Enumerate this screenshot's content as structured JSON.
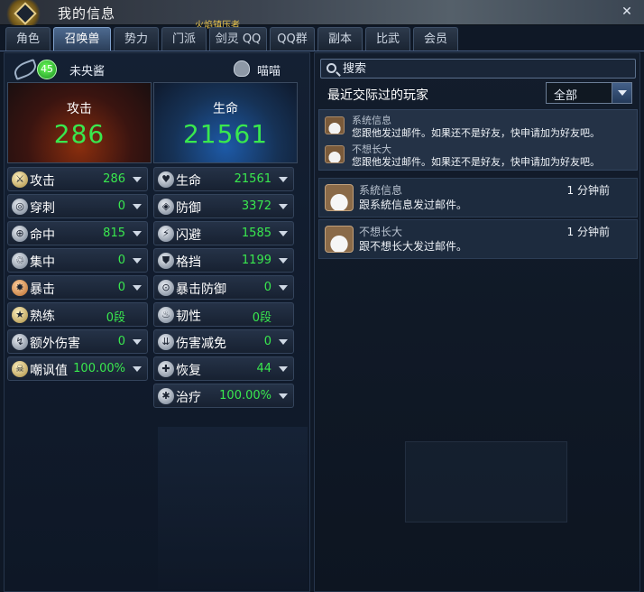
{
  "window": {
    "title": "我的信息",
    "close": "✕",
    "decoration": "火焰镇压者"
  },
  "tabs": [
    "角色",
    "召唤兽",
    "势力",
    "门派",
    "剑灵 QQ",
    "QQ群",
    "副本",
    "比武",
    "会员"
  ],
  "active_tab": "召唤兽",
  "pet": {
    "level": "45",
    "name": "未央酱",
    "owner": "喵喵"
  },
  "cards": {
    "attack": {
      "label": "攻击",
      "value": "286"
    },
    "life": {
      "label": "生命",
      "value": "21561"
    }
  },
  "left_stats": [
    {
      "icon": "swords-icon",
      "label": "攻击",
      "value": "286"
    },
    {
      "icon": "pierce-icon",
      "label": "穿刺",
      "value": "0"
    },
    {
      "icon": "target-icon",
      "label": "命中",
      "value": "815"
    },
    {
      "icon": "focus-icon",
      "label": "集中",
      "value": "0"
    },
    {
      "icon": "burst-icon",
      "label": "暴击",
      "value": "0"
    },
    {
      "icon": "mastery-icon",
      "label": "熟练",
      "value": "0段"
    },
    {
      "icon": "bonus-damage-icon",
      "label": "额外伤害",
      "value": "0"
    },
    {
      "icon": "skull-icon",
      "label": "嘲讽值",
      "value": "100.00%"
    }
  ],
  "right_stats": [
    {
      "icon": "heart-icon",
      "label": "生命",
      "value": "21561"
    },
    {
      "icon": "shield-icon",
      "label": "防御",
      "value": "3372"
    },
    {
      "icon": "dodge-icon",
      "label": "闪避",
      "value": "1585"
    },
    {
      "icon": "block-icon",
      "label": "格挡",
      "value": "1199"
    },
    {
      "icon": "crit-defense-icon",
      "label": "暴击防御",
      "value": "0"
    },
    {
      "icon": "toughness-icon",
      "label": "韧性",
      "value": "0段"
    },
    {
      "icon": "damage-reduction-icon",
      "label": "伤害减免",
      "value": "0"
    },
    {
      "icon": "recovery-icon",
      "label": "恢复",
      "value": "44"
    },
    {
      "icon": "heal-icon",
      "label": "治疗",
      "value": "100.00%"
    }
  ],
  "search": {
    "placeholder": "搜索"
  },
  "recent": {
    "title": "最近交际过的玩家",
    "filter": "全部"
  },
  "notices": [
    {
      "name": "系统信息",
      "text": "您跟他发过邮件。如果还不是好友，快申请加为好友吧。"
    },
    {
      "name": "不想长大",
      "text": "您跟他发过邮件。如果还不是好友，快申请加为好友吧。"
    }
  ],
  "messages": [
    {
      "name": "系統信息",
      "time": "1 分钟前",
      "text": "跟系統信息发过邮件。"
    },
    {
      "name": "不想长大",
      "time": "1 分钟前",
      "text": "跟不想长大发过邮件。"
    }
  ],
  "colors": {
    "value_green": "#39e84e",
    "accent_blue": "#4d6a90",
    "panel_bg": "#142033"
  }
}
